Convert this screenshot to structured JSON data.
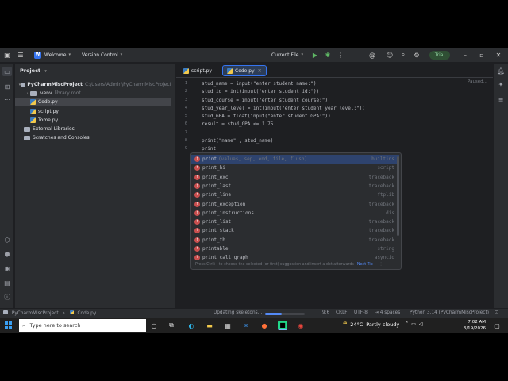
{
  "titlebar": {
    "welcome": "Welcome",
    "project_badge": "W",
    "vcs": "Version Control",
    "run_config": "Current File",
    "trial": "Trial",
    "icons": [
      "hamburger-icon",
      "run-icon",
      "debug-icon",
      "more-icon",
      "code-with-me-icon",
      "profile-icon",
      "search-icon",
      "settings-icon",
      "minimize-icon",
      "maximize-icon",
      "close-icon"
    ]
  },
  "left_strip": {
    "icons": [
      "project-icon",
      "structure-icon",
      "more-tools-icon",
      "python-packages-icon",
      "services-icon",
      "python-console-icon",
      "terminal-icon",
      "problems-icon"
    ]
  },
  "right_strip": {
    "icons": [
      "notifications-icon",
      "ai-assistant-icon",
      "database-icon"
    ]
  },
  "project_panel": {
    "title": "Project",
    "tree": [
      {
        "label": "PyCharmMiscProject",
        "hint": "C:\\Users\\Admin\\PyCharmMiscProject",
        "kind": "folder",
        "expanded": true
      },
      {
        "label": ".venv",
        "hint": "library root",
        "kind": "folder",
        "expanded": false
      },
      {
        "label": "Code.py",
        "hint": "",
        "kind": "py",
        "selected": true
      },
      {
        "label": "script.py",
        "hint": "",
        "kind": "py"
      },
      {
        "label": "Tome.py",
        "hint": "",
        "kind": "py"
      },
      {
        "label": "External Libraries",
        "hint": "",
        "kind": "folder",
        "expanded": false
      },
      {
        "label": "Scratches and Consoles",
        "hint": "",
        "kind": "folder",
        "expanded": false
      }
    ]
  },
  "editor": {
    "tabs": [
      {
        "label": "script.py",
        "active": false
      },
      {
        "label": "Code.py",
        "active": true
      }
    ],
    "status_hint": "Paused...",
    "line_numbers": [
      "1",
      "2",
      "3",
      "4",
      "5",
      "6",
      "7",
      "8",
      "9"
    ],
    "lines": [
      "stud_name = input(\"enter student name:\")",
      "stud_id = int(input(\"enter student id:\"))",
      "stud_course = input(\"enter student course:\")",
      "stud_year_level = int(input(\"enter student year level:\"))",
      "stud_GPA = float(input(\"enter student GPA:\"))",
      "result = stud_GPA <= 1.75",
      "",
      "print(\"name\" , stud_name)",
      "print"
    ]
  },
  "completion": {
    "items": [
      {
        "name": "print",
        "sig": "(values, sep, end, file, flush)",
        "source": "builtins"
      },
      {
        "name": "print_hi",
        "sig": "",
        "source": "script"
      },
      {
        "name": "print_exc",
        "sig": "",
        "source": "traceback"
      },
      {
        "name": "print_last",
        "sig": "",
        "source": "traceback"
      },
      {
        "name": "print_line",
        "sig": "",
        "source": "ftplib"
      },
      {
        "name": "print_exception",
        "sig": "",
        "source": "traceback"
      },
      {
        "name": "print_instructions",
        "sig": "",
        "source": "dis"
      },
      {
        "name": "print_list",
        "sig": "",
        "source": "traceback"
      },
      {
        "name": "print_stack",
        "sig": "",
        "source": "traceback"
      },
      {
        "name": "print_tb",
        "sig": "",
        "source": "traceback"
      },
      {
        "name": "printable",
        "sig": "",
        "source": "string"
      },
      {
        "name": "print_call_graph",
        "sig": "",
        "source": "asyncio"
      }
    ],
    "footer_hint": "Press Ctrl+. to choose the selected (or first) suggestion and insert a dot afterwards",
    "footer_link": "Next Tip"
  },
  "statusbar": {
    "breadcrumb_project": "PyCharmMiscProject",
    "breadcrumb_file": "Code.py",
    "task": "Updating skeletons...",
    "progress": 0.42,
    "position": "9:6",
    "line_sep": "CRLF",
    "encoding": "UTF-8",
    "indent": "4 spaces",
    "interpreter": "Python 3.14 (PyCharmMiscProject)"
  },
  "taskbar": {
    "search_placeholder": "Type here to search",
    "temperature": "24°C",
    "weather": "Partly cloudy",
    "time": "7:02 AM",
    "date": "3/19/2026",
    "icons": [
      "cortana-icon",
      "task-view-icon",
      "edge-icon",
      "file-explorer-icon",
      "store-icon",
      "mail-icon",
      "firefox-icon",
      "pycharm-icon",
      "chrome-icon"
    ]
  }
}
